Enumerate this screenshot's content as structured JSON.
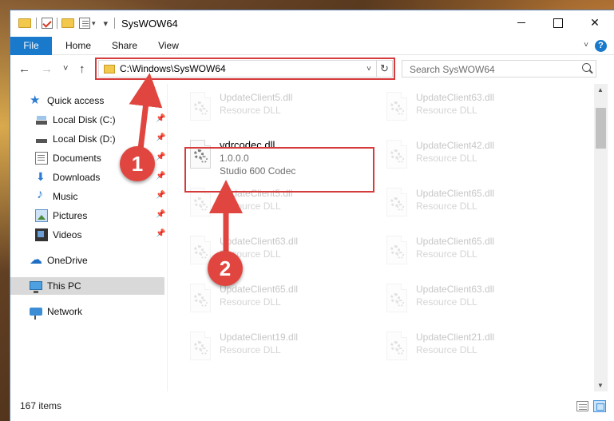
{
  "window": {
    "title": "SysWOW64",
    "close_glyph": "✕"
  },
  "ribbon": {
    "tabs": [
      "File",
      "Home",
      "Share",
      "View"
    ],
    "help_glyph": "?",
    "collapse_glyph": "˅"
  },
  "nav": {
    "back_glyph": "←",
    "forward_glyph": "→",
    "recent_glyph": "˅",
    "up_glyph": "↑",
    "address_path": "C:\\Windows\\SysWOW64",
    "address_drop_glyph": "˅",
    "refresh_glyph": "↻",
    "search_placeholder": "Search SysWOW64"
  },
  "sidebar": {
    "items": [
      {
        "label": "Quick access",
        "icon": "star-icon",
        "pinned": false
      },
      {
        "label": "Local Disk (C:)",
        "icon": "drive-icon",
        "pinned": true
      },
      {
        "label": "Local Disk (D:)",
        "icon": "drive-icon",
        "pinned": true
      },
      {
        "label": "Documents",
        "icon": "documents-icon",
        "pinned": true
      },
      {
        "label": "Downloads",
        "icon": "download-icon",
        "pinned": true
      },
      {
        "label": "Music",
        "icon": "music-icon",
        "pinned": true
      },
      {
        "label": "Pictures",
        "icon": "pictures-icon",
        "pinned": true
      },
      {
        "label": "Videos",
        "icon": "videos-icon",
        "pinned": true
      },
      {
        "label": "OneDrive",
        "icon": "cloud-icon",
        "pinned": false
      },
      {
        "label": "This PC",
        "icon": "computer-icon",
        "pinned": false,
        "selected": true
      },
      {
        "label": "Network",
        "icon": "network-icon",
        "pinned": false
      }
    ],
    "pin_glyph": "📌"
  },
  "files": {
    "left_column": [
      {
        "name": "UpdateClient5.dll",
        "desc": "Resource DLL"
      },
      {
        "name": "vdrcodec.dll",
        "version": "1.0.0.0",
        "desc": "Studio 600 Codec",
        "focused": true
      },
      {
        "name": "UpdateClient5.dll",
        "desc": "Resource DLL"
      },
      {
        "name": "UpdateClient63.dll",
        "desc": "Resource DLL"
      },
      {
        "name": "UpdateClient65.dll",
        "desc": "Resource DLL"
      },
      {
        "name": "UpdateClient19.dll",
        "desc": "Resource DLL"
      }
    ],
    "right_column": [
      {
        "name": "UpdateClient63.dll",
        "desc": "Resource DLL"
      },
      {
        "name": "UpdateClient42.dll",
        "desc": "Resource DLL"
      },
      {
        "name": "UpdateClient65.dll",
        "desc": "Resource DLL"
      },
      {
        "name": "UpdateClient65.dll",
        "desc": "Resource DLL"
      },
      {
        "name": "UpdateClient63.dll",
        "desc": "Resource DLL"
      },
      {
        "name": "UpdateClient21.dll",
        "desc": "Resource DLL"
      }
    ]
  },
  "status": {
    "item_count": "167 items"
  },
  "annotations": {
    "step1": "1",
    "step2": "2",
    "color": "#e0463f"
  }
}
